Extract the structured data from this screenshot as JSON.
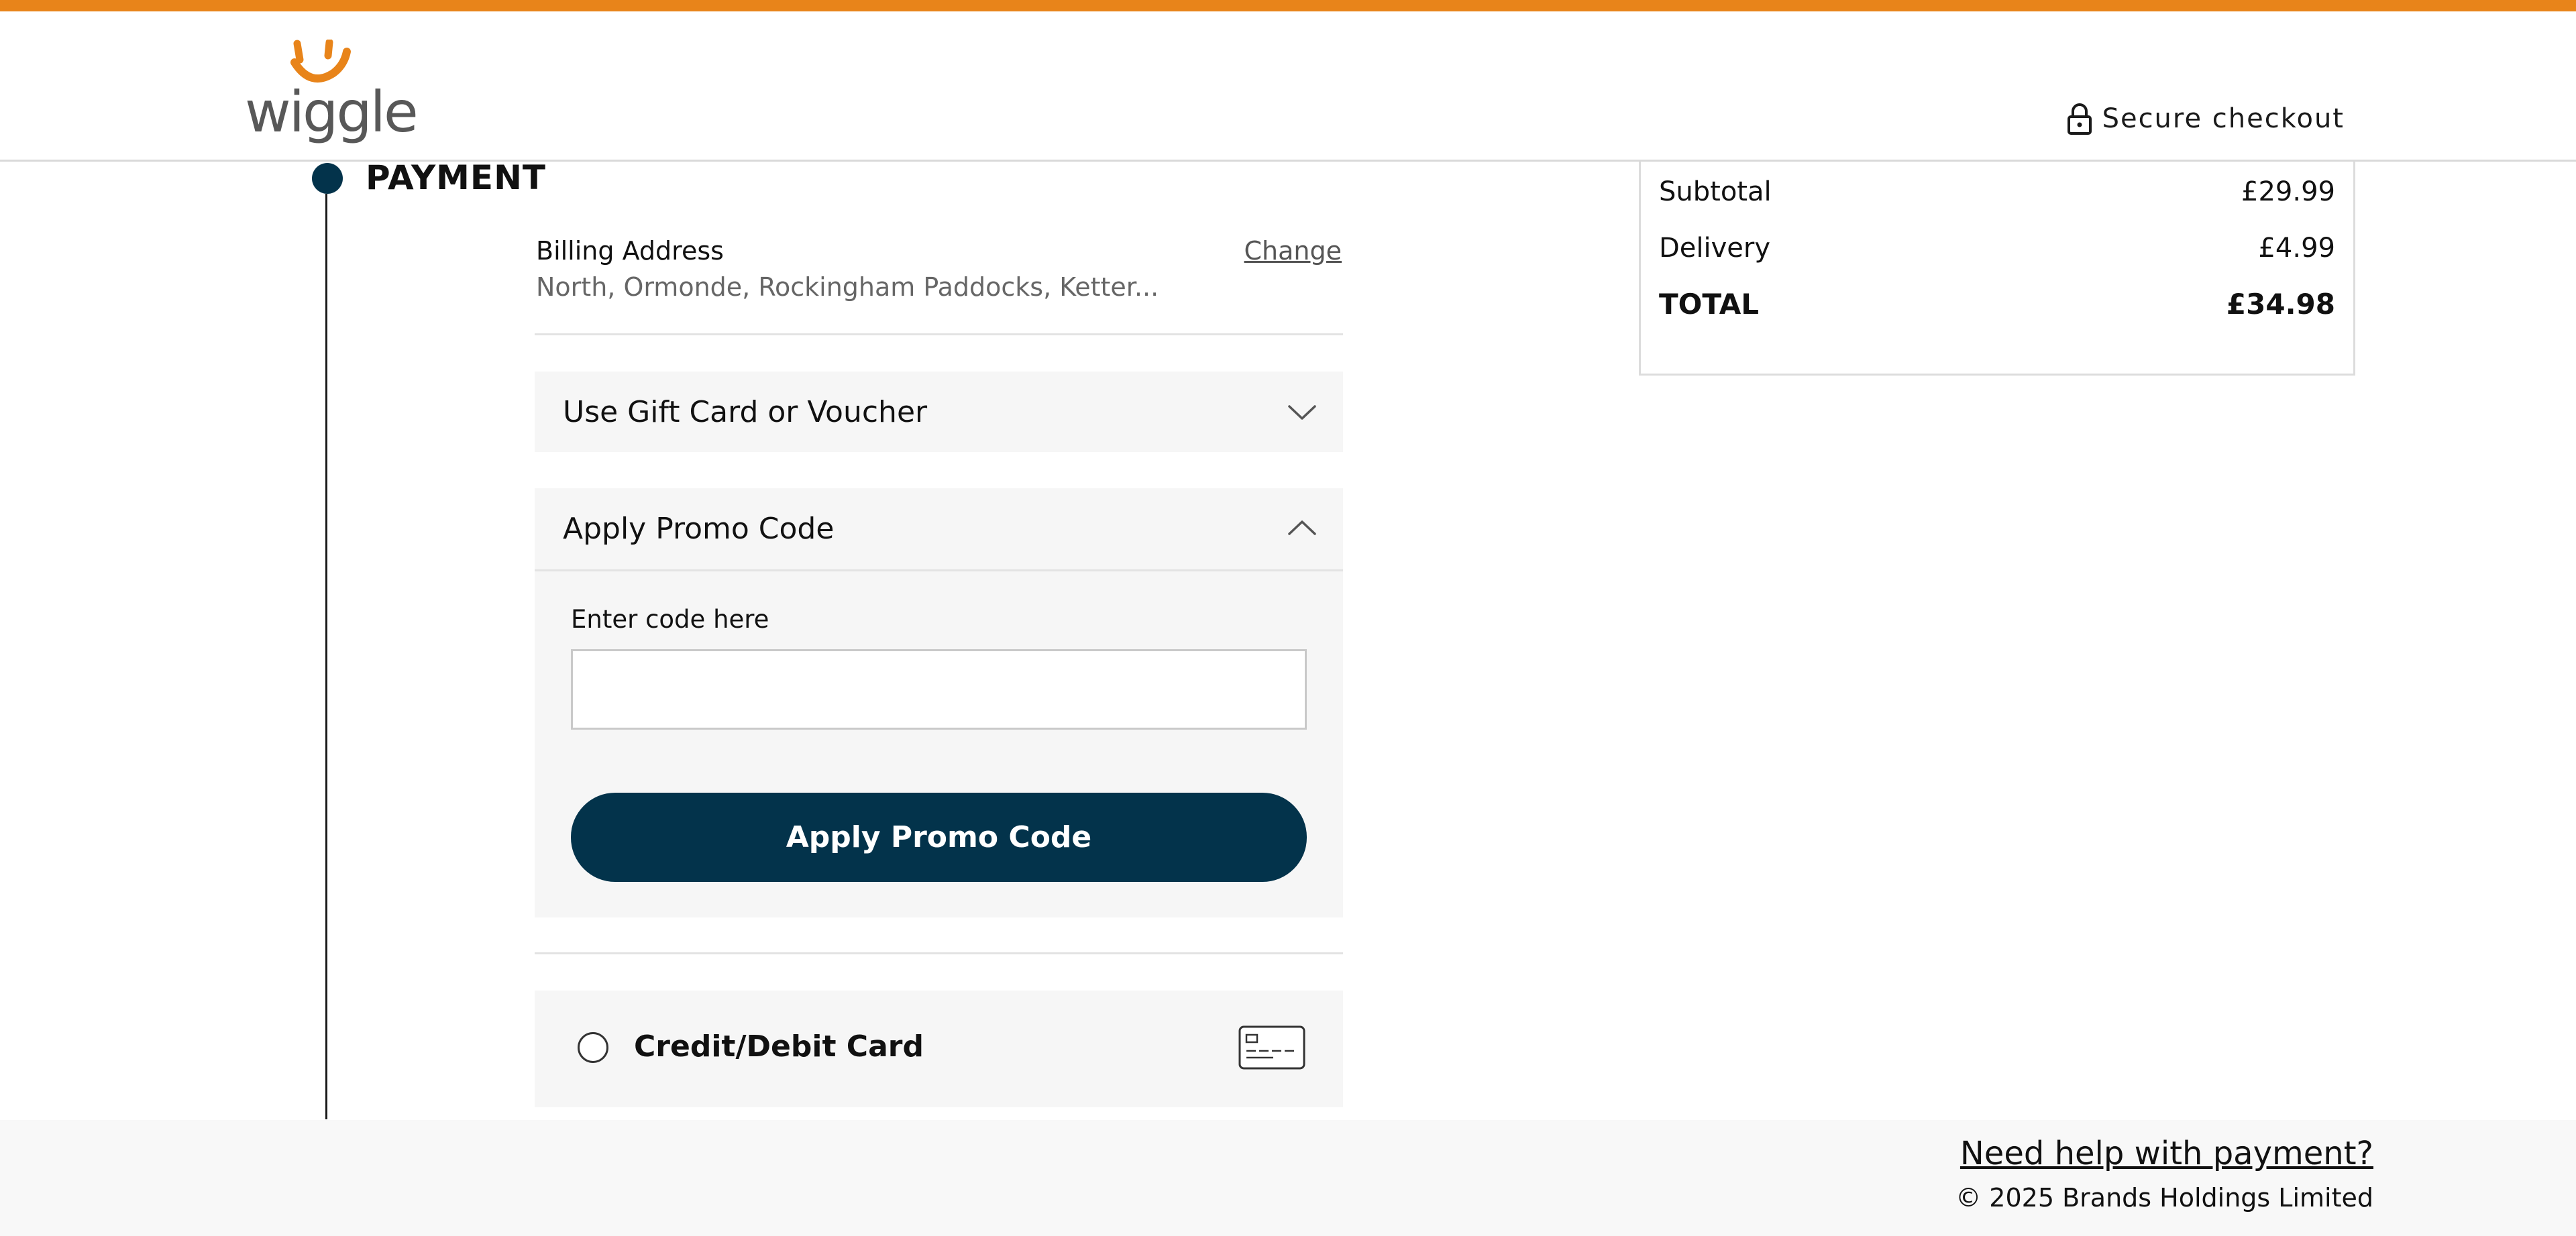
{
  "brand": {
    "name": "wiggle",
    "accent_color": "#e8841a",
    "primary_color": "#03334b",
    "logo_icon": "smile-icon"
  },
  "header": {
    "secure_label": "Secure checkout",
    "secure_icon": "lock-icon"
  },
  "step": {
    "title": "PAYMENT"
  },
  "billing": {
    "label": "Billing Address",
    "value": "North, Ormonde, Rockingham Paddocks, Ketter...",
    "change_label": "Change"
  },
  "gift_card": {
    "title": "Use Gift Card or Voucher",
    "expanded": false,
    "icon": "chevron-down-icon"
  },
  "promo": {
    "title": "Apply Promo Code",
    "expanded": true,
    "icon": "chevron-up-icon",
    "field_label": "Enter code here",
    "field_value": "",
    "button_label": "Apply Promo Code"
  },
  "payment_methods": [
    {
      "label": "Credit/Debit Card",
      "selected": false,
      "icon": "credit-card-icon"
    }
  ],
  "summary": {
    "subtotal_label": "Subtotal",
    "subtotal_value": "£29.99",
    "delivery_label": "Delivery",
    "delivery_value": "£4.99",
    "total_label": "TOTAL",
    "total_value": "£34.98"
  },
  "footer": {
    "help_link": "Need help with payment?",
    "copyright": "© 2025 Brands Holdings Limited"
  }
}
